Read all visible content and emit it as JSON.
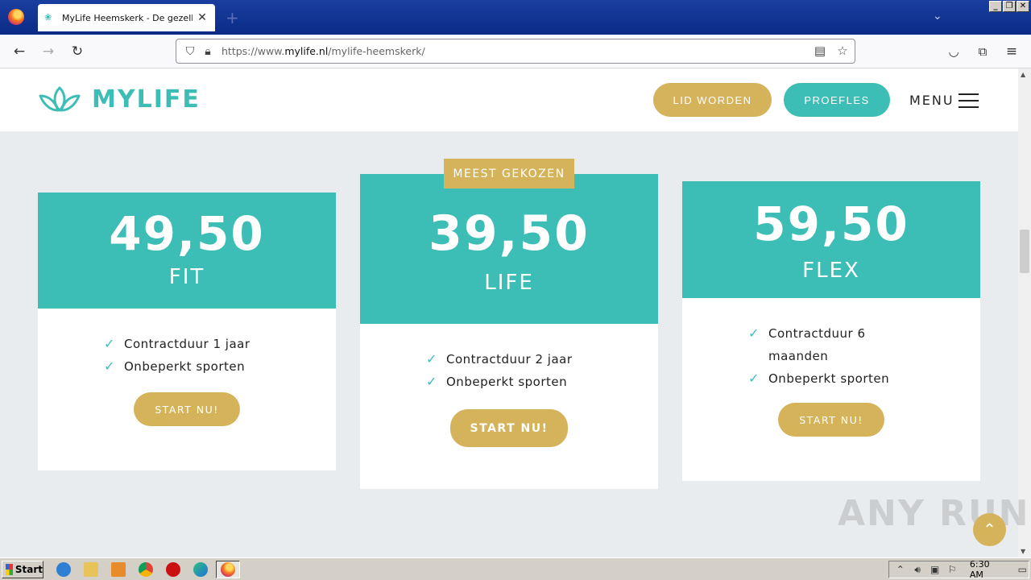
{
  "browser": {
    "tab_title": "MyLife Heemskerk - De gezelligste",
    "url_prefix": "https://www.",
    "url_domain": "mylife.nl",
    "url_path": "/mylife-heemskerk/"
  },
  "header": {
    "logo_text": "MYLIFE",
    "lid_worden": "LID WORDEN",
    "proefles": "PROEFLES",
    "menu": "MENU"
  },
  "plans": [
    {
      "price": "49,50",
      "name": "FIT",
      "features": [
        "Contractduur 1 jaar",
        "Onbeperkt sporten"
      ],
      "cta": "START NU!"
    },
    {
      "price": "39,50",
      "name": "LIFE",
      "badge": "MEEST GEKOZEN",
      "features": [
        "Contractduur 2 jaar",
        "Onbeperkt sporten"
      ],
      "cta": "START NU!"
    },
    {
      "price": "59,50",
      "name": "FLEX",
      "features": [
        "Contractduur 6 maanden",
        "Onbeperkt sporten"
      ],
      "cta": "START NU!"
    }
  ],
  "watermark": "ANY RUN",
  "taskbar": {
    "start": "Start",
    "clock": "6:30 AM"
  },
  "colors": {
    "teal": "#3cbdb5",
    "gold": "#d5b35a"
  }
}
